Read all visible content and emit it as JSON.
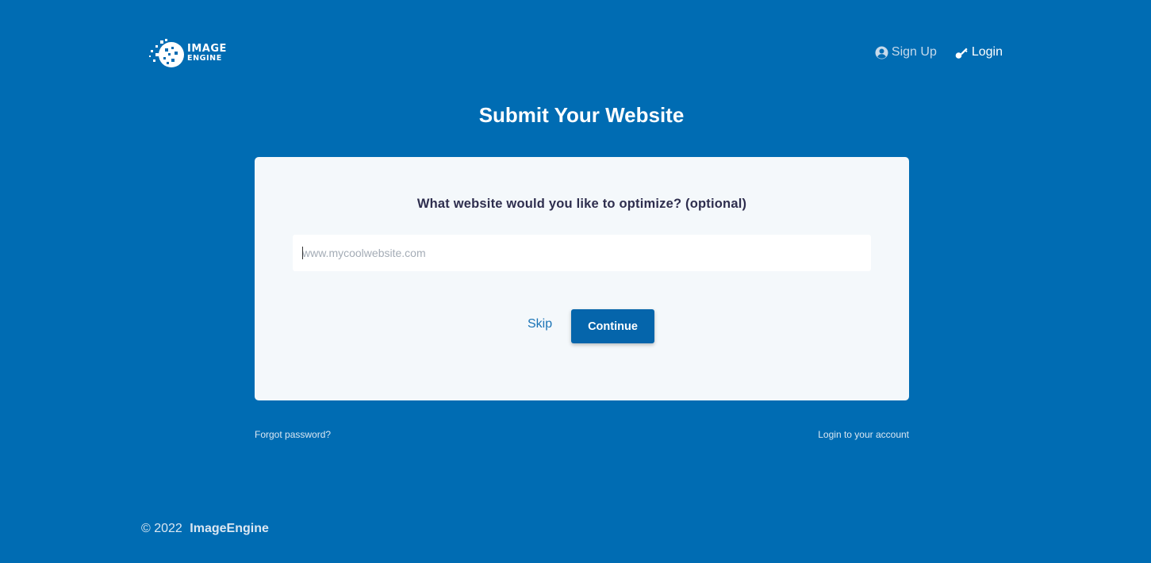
{
  "header": {
    "logo": {
      "line1": "IMAGE",
      "line2": "ENGINE",
      "icon": "image-engine-logo"
    },
    "nav": {
      "signup": {
        "label": "Sign Up",
        "icon": "user-circle-icon"
      },
      "login": {
        "label": "Login",
        "icon": "key-icon"
      }
    }
  },
  "main": {
    "title": "Submit Your Website",
    "card": {
      "question": "What website would you like to optimize? (optional)",
      "input": {
        "placeholder": "www.mycoolwebsite.com",
        "value": ""
      },
      "skip_label": "Skip",
      "continue_label": "Continue"
    },
    "links": {
      "forgot_password": "Forgot password?",
      "login_account": "Login to your account"
    }
  },
  "footer": {
    "copyright": "© 2022",
    "brand": "ImageEngine"
  },
  "colors": {
    "background": "#006cb3",
    "card": "#f4f8fb",
    "button": "#0565ab",
    "link": "#1b74b6",
    "question_text": "#2e2e4e"
  }
}
